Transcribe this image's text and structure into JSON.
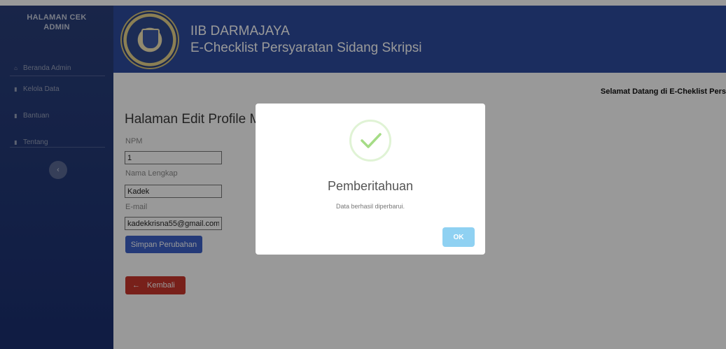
{
  "sidebar": {
    "brand_line1": "HALAMAN CEK",
    "brand_line2": "ADMIN",
    "items": [
      {
        "label": "Beranda Admin",
        "icon": "home-icon"
      },
      {
        "label": "Kelola Data",
        "icon": "file-icon"
      },
      {
        "label": "Bantuan",
        "icon": "file-icon"
      },
      {
        "label": "Tentang",
        "icon": "file-icon"
      }
    ],
    "collapse_icon": "chevron-left-icon"
  },
  "header": {
    "title": "IIB DARMAJAYA",
    "subtitle": "E-Checklist Persyaratan Sidang Skripsi"
  },
  "main": {
    "welcome": "Selamat Datang di E-Cheklist Pers",
    "page_title": "Halaman Edit Profile M",
    "form": {
      "npm_label": "NPM",
      "npm_value": "1",
      "nama_label": "Nama Lengkap",
      "nama_value": "Kadek",
      "email_label": "E-mail",
      "email_value": "kadekkrisna55@gmail.com",
      "save_label": "Simpan Perubahan"
    },
    "back_label": "Kembali"
  },
  "modal": {
    "title": "Pemberitahuan",
    "message": "Data berhasil diperbarui.",
    "ok_label": "OK",
    "icon": "success-check-icon"
  },
  "colors": {
    "header": "#2d4c9e",
    "sidebar": "#223876",
    "save_button": "#3d62c8",
    "back_button": "#c8362c",
    "ok_button": "#8fd1f2",
    "check": "#a5dc86"
  }
}
